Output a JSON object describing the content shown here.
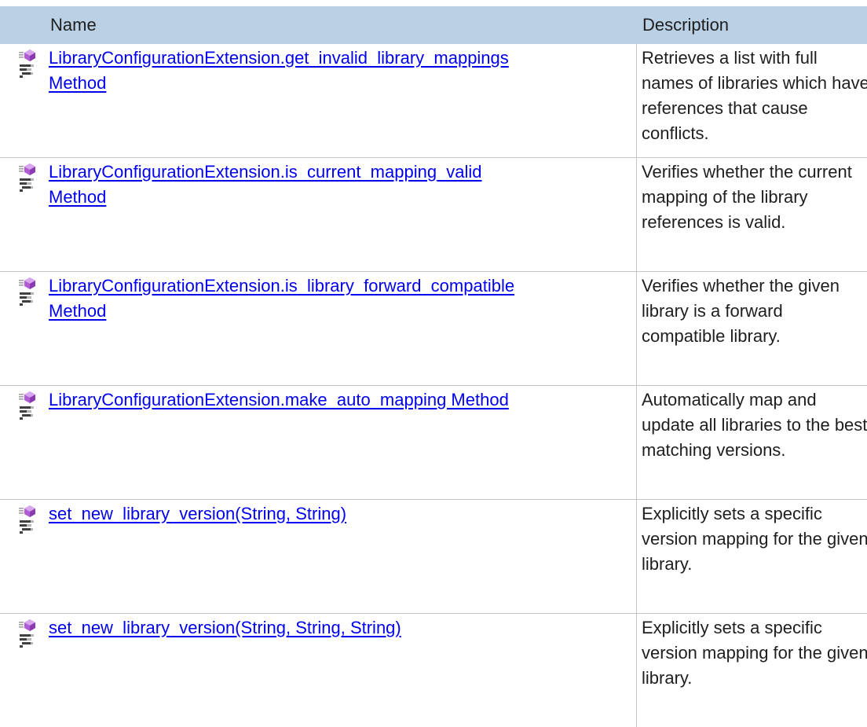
{
  "columns": {
    "name": "Name",
    "description": "Description"
  },
  "rows": [
    {
      "name_line1": "LibraryConfigurationExtension.get_invalid_library_mappings ",
      "name_line2": "Method",
      "description": "Retrieves a list with full names of libraries which have references that cause conflicts.",
      "icons": [
        "method-icon",
        "static-icon"
      ]
    },
    {
      "name_line1": "LibraryConfigurationExtension.is_current_mapping_valid ",
      "name_line2": "Method",
      "description": "Verifies whether the current mapping of the library references is valid.",
      "icons": [
        "method-icon",
        "static-icon"
      ]
    },
    {
      "name_line1": "LibraryConfigurationExtension.is_library_forward_compatible ",
      "name_line2": "Method",
      "description": "Verifies whether the given library is a forward compatible library.",
      "icons": [
        "method-icon",
        "static-icon"
      ]
    },
    {
      "name_line1": "LibraryConfigurationExtension.make_auto_mapping Method",
      "name_line2": "",
      "description": "Automatically map and update all libraries to the best matching versions.",
      "icons": [
        "method-icon",
        "static-icon"
      ]
    },
    {
      "name_line1": "set_new_library_version(String, String)",
      "name_line2": "",
      "description": "Explicitly sets a specific version mapping for the given library.",
      "icons": [
        "method-icon",
        "static-icon"
      ]
    },
    {
      "name_line1": "set_new_library_version(String, String, String)",
      "name_line2": "",
      "description": "Explicitly sets a specific version mapping for the given library.",
      "icons": [
        "method-icon",
        "static-icon"
      ]
    }
  ],
  "colors": {
    "header_bg": "#bad0e5",
    "link": "#0000ee",
    "grid": "#c5c5c5",
    "method_icon": "#b15bd6"
  }
}
